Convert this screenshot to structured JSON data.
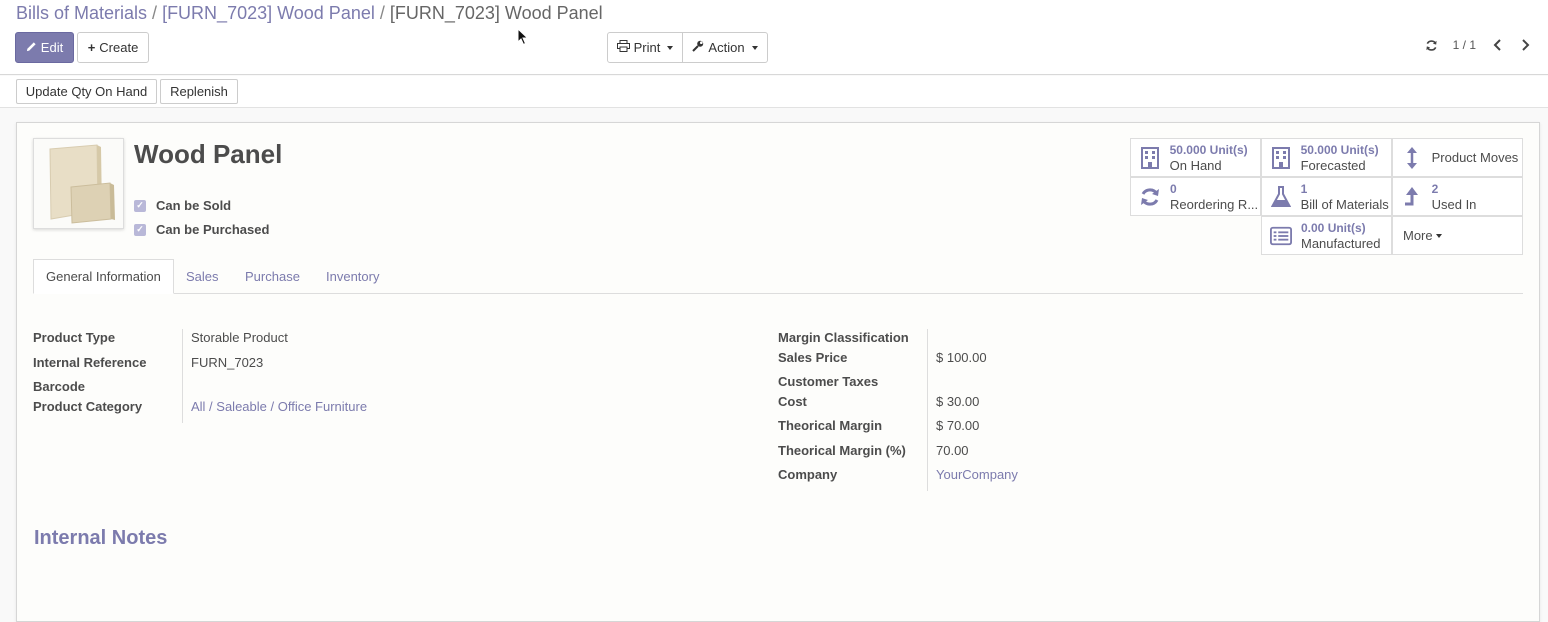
{
  "breadcrumb": {
    "items": [
      "Bills of Materials",
      "[FURN_7023] Wood Panel"
    ],
    "current": "[FURN_7023] Wood Panel",
    "separator": "/"
  },
  "toolbar": {
    "edit_label": "Edit",
    "create_label": "Create",
    "print_label": "Print",
    "action_label": "Action"
  },
  "pager": {
    "value": "1 / 1"
  },
  "statusbar": {
    "update_qty_label": "Update Qty On Hand",
    "replenish_label": "Replenish"
  },
  "product": {
    "name": "Wood Panel",
    "can_be_sold": "Can be Sold",
    "can_be_purchased": "Can be Purchased"
  },
  "smart_buttons": [
    {
      "icon": "building-icon",
      "value": "50.000 Unit(s)",
      "label": "On Hand"
    },
    {
      "icon": "building-icon",
      "value": "50.000 Unit(s)",
      "label": "Forecasted"
    },
    {
      "icon": "arrows-vertical-icon",
      "value": "",
      "label": "Product Moves"
    },
    {
      "icon": "refresh-icon",
      "value": "0",
      "label": "Reordering R..."
    },
    {
      "icon": "flask-icon",
      "value": "1",
      "label": "Bill of Materials"
    },
    {
      "icon": "level-up-icon",
      "value": "2",
      "label": "Used In"
    },
    {
      "icon": "list-icon",
      "value": "0.00 Unit(s)",
      "label": "Manufactured"
    },
    {
      "icon": "",
      "value": "",
      "label": "More"
    }
  ],
  "tabs": [
    "General Information",
    "Sales",
    "Purchase",
    "Inventory"
  ],
  "left_fields": [
    {
      "label": "Product Type",
      "value": "Storable Product"
    },
    {
      "label": "Internal Reference",
      "value": "FURN_7023"
    },
    {
      "label": "Barcode",
      "value": ""
    },
    {
      "label": "Product Category",
      "value": "All / Saleable / Office Furniture"
    }
  ],
  "right_fields": [
    {
      "label": "Margin Classification",
      "value": ""
    },
    {
      "label": "Sales Price",
      "value": "$ 100.00"
    },
    {
      "label": "Customer Taxes",
      "value": ""
    },
    {
      "label": "Cost",
      "value": "$ 30.00"
    },
    {
      "label": "Theorical Margin",
      "value": "$ 70.00"
    },
    {
      "label": "Theorical Margin (%)",
      "value": "70.00"
    },
    {
      "label": "Company",
      "value": "YourCompany"
    }
  ],
  "notes": {
    "title": "Internal Notes"
  },
  "colors": {
    "accent": "#7c7bad",
    "text": "#4c4c4c",
    "border": "#dddddd"
  }
}
